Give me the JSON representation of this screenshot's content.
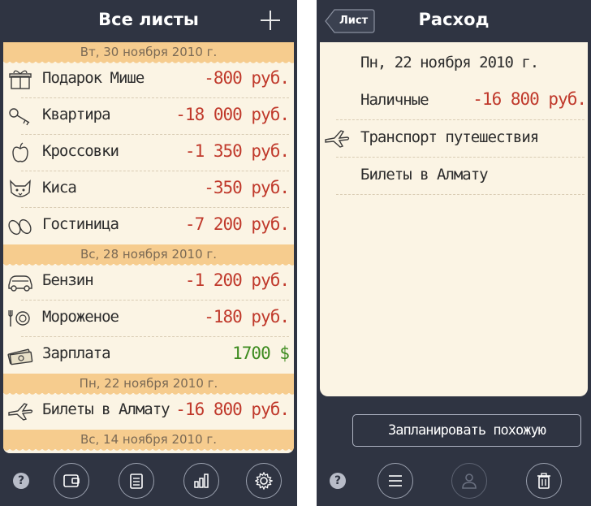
{
  "left": {
    "title": "Все листы",
    "sections": [
      {
        "date": "Вт, 30 ноября 2010 г.",
        "items": [
          {
            "label": "Подарок Мише",
            "amount": "-800 руб.",
            "icon": "gift-icon",
            "positive": false
          },
          {
            "label": "Квартира",
            "amount": "-18 000 руб.",
            "icon": "keys-icon",
            "positive": false
          },
          {
            "label": "Кроссовки",
            "amount": "-1 350 руб.",
            "icon": "apple-icon",
            "positive": false
          },
          {
            "label": "Киса",
            "amount": "-350 руб.",
            "icon": "cat-icon",
            "positive": false
          },
          {
            "label": "Гостиница",
            "amount": "-7 200 руб.",
            "icon": "slippers-icon",
            "positive": false
          }
        ]
      },
      {
        "date": "Вс, 28 ноября 2010 г.",
        "items": [
          {
            "label": "Бензин",
            "amount": "-1 200 руб.",
            "icon": "car-icon",
            "positive": false
          },
          {
            "label": "Мороженое",
            "amount": "-180 руб.",
            "icon": "cutlery-icon",
            "positive": false
          },
          {
            "label": "Зарплата",
            "amount": "1700 $",
            "icon": "money-icon",
            "positive": true
          }
        ]
      },
      {
        "date": "Пн, 22 ноября 2010 г.",
        "items": [
          {
            "label": "Билеты в Алмату",
            "amount": "-16 800 руб.",
            "icon": "plane-icon",
            "positive": false
          }
        ]
      },
      {
        "date": "Вс, 14 ноября 2010 г.",
        "items": []
      }
    ],
    "tabs": [
      "help-icon",
      "wallet-icon",
      "notepad-icon",
      "bar-chart-icon",
      "gear-icon"
    ],
    "help_label": "?"
  },
  "right": {
    "back_label": "Лист",
    "title": "Расход",
    "date": "Пн, 22 ноября 2010 г.",
    "account": "Наличные",
    "amount": "-16 800 руб.",
    "category": "Транспорт путешествия",
    "note": "Билеты в Алмату",
    "plan_label": "Запланировать похожую",
    "help_label": "?",
    "tabs": [
      "help-icon",
      "menu-icon",
      "person-icon",
      "trash-icon"
    ]
  },
  "colors": {
    "bar": "#2f3442",
    "paper": "#fbf4e4",
    "section": "#f6cc8e",
    "expense": "#c0392b",
    "income": "#3d8b1f"
  }
}
